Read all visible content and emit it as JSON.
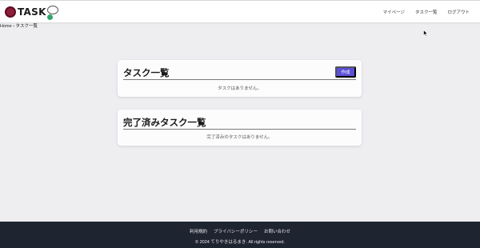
{
  "header": {
    "logo_text": "TASK",
    "nav": [
      "マイページ",
      "タスク一覧",
      "ログアウト"
    ]
  },
  "breadcrumb": "Home › タスク一覧",
  "task_list": {
    "title": "タスク一覧",
    "create_label": "作成",
    "empty_message": "タスクはありません。"
  },
  "completed_list": {
    "title": "完了済みタスク一覧",
    "empty_message": "完了済みのタスクはありません。"
  },
  "footer": {
    "links": [
      "利用規約",
      "プライバシーポリシー",
      "お問い合わせ"
    ],
    "copyright": "© 2024 てりやきはるまき. All rights reserved."
  },
  "colors": {
    "accent": "#5b4fd9",
    "footer_bg": "#1f2431",
    "page_bg": "#eeeef1"
  }
}
